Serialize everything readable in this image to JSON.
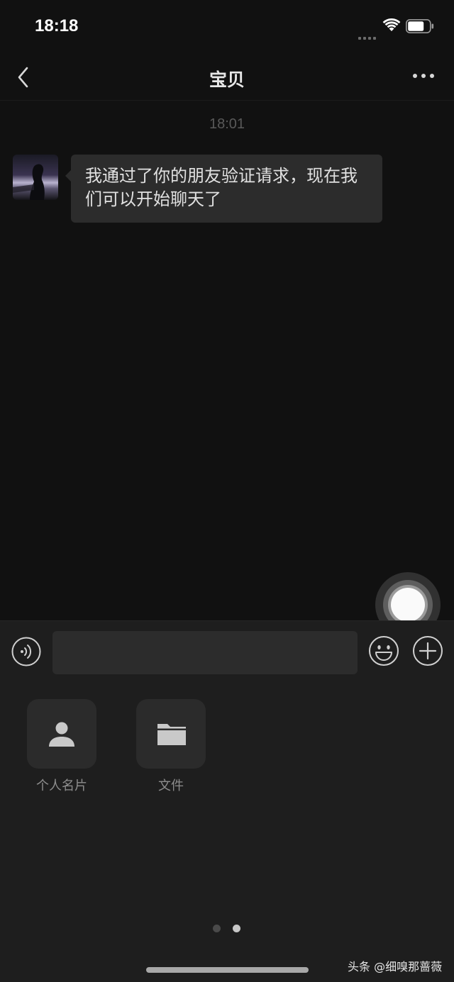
{
  "status_bar": {
    "time": "18:18"
  },
  "nav": {
    "title": "宝贝"
  },
  "chat": {
    "timestamp": "18:01",
    "messages": [
      {
        "sender": "contact",
        "text": "我通过了你的朋友验证请求，现在我们可以开始聊天了"
      }
    ]
  },
  "input_bar": {
    "value": "",
    "placeholder": ""
  },
  "panel": {
    "items": [
      {
        "label": "个人名片",
        "icon": "person-card-icon"
      },
      {
        "label": "文件",
        "icon": "folder-icon"
      }
    ],
    "page_count": 2,
    "active_page": 2
  },
  "watermark": "头条 @细嗅那蔷薇",
  "colors": {
    "background": "#111111",
    "bubble": "#2c2c2c",
    "panel": "#1e1e1e",
    "dot_active": "#c8c8c8",
    "dot_inactive": "#4a4a4a"
  }
}
